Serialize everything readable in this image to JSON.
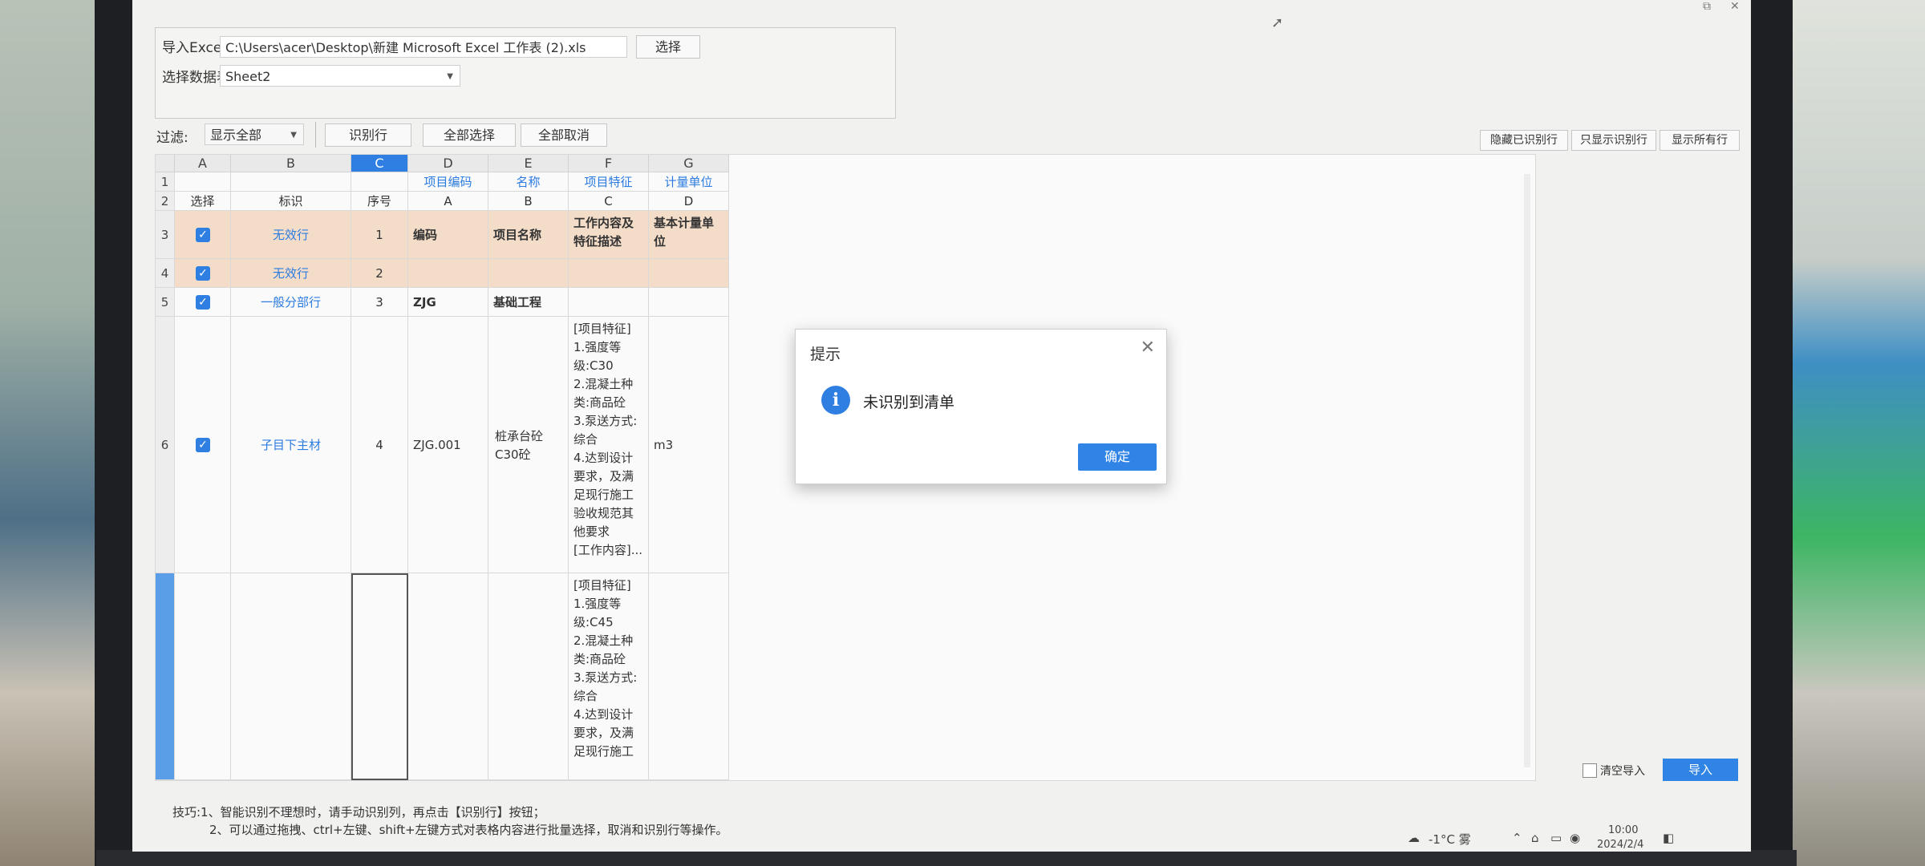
{
  "import": {
    "excel_label": "导入Excel表",
    "excel_path": "C:\\Users\\acer\\Desktop\\新建 Microsoft Excel 工作表 (2).xls",
    "choose_button": "选择",
    "sheet_label": "选择数据表",
    "sheet_value": "Sheet2"
  },
  "toolbar": {
    "filter_label": "过滤:",
    "filter_value": "显示全部",
    "identify_row": "识别行",
    "select_all": "全部选择",
    "deselect_all": "全部取消",
    "hide_identified": "隐藏已识别行",
    "show_identified_only": "只显示识别行",
    "show_all_rows": "显示所有行"
  },
  "grid": {
    "col_letters": [
      "A",
      "B",
      "C",
      "D",
      "E",
      "F",
      "G"
    ],
    "row1": {
      "num": "1",
      "d": "项目编码",
      "e": "名称",
      "f": "项目特征",
      "g": "计量单位"
    },
    "row2": {
      "num": "2",
      "a": "选择",
      "b": "标识",
      "c": "序号",
      "d": "A",
      "e": "B",
      "f": "C",
      "g": "D"
    },
    "row3": {
      "num": "3",
      "b": "无效行",
      "c": "1",
      "d": "编码",
      "e": "项目名称",
      "f": "工作内容及特征描述",
      "g": "基本计量单位"
    },
    "row4": {
      "num": "4",
      "b": "无效行",
      "c": "2"
    },
    "row5": {
      "num": "5",
      "b": "一般分部行",
      "c": "3",
      "d": "ZJG",
      "e": "基础工程"
    },
    "row6": {
      "num": "6",
      "b": "子目下主材",
      "c": "4",
      "d": "ZJG.001",
      "e": "桩承台砼C30砼",
      "f": "[项目特征]\n1.强度等级:C30\n2.混凝土种类:商品砼\n3.泵送方式:综合\n4.达到设计要求，及满足现行施工验收规范其他要求\n[工作内容]...",
      "g": "m3"
    },
    "row7": {
      "f": "[项目特征]\n1.强度等级:C45\n2.混凝土种类:商品砼\n3.泵送方式:综合\n4.达到设计要求，及满足现行施工"
    }
  },
  "dialog": {
    "title": "提示",
    "message": "未识别到清单",
    "ok": "确定"
  },
  "footer": {
    "clear_import": "清空导入",
    "import_button": "导入",
    "tip1": "技巧:1、智能识别不理想时，请手动识别列，再点击【识别行】按钮；",
    "tip2": "2、可以通过拖拽、ctrl+左键、shift+左键方式对表格内容进行批量选择，取消和识别行等操作。"
  },
  "taskbar": {
    "weather": "-1°C 雾",
    "time": "10:00",
    "date": "2024/2/4"
  },
  "colors": {
    "accent": "#2f7fe3",
    "invalid_row": "#f3dcc8"
  }
}
